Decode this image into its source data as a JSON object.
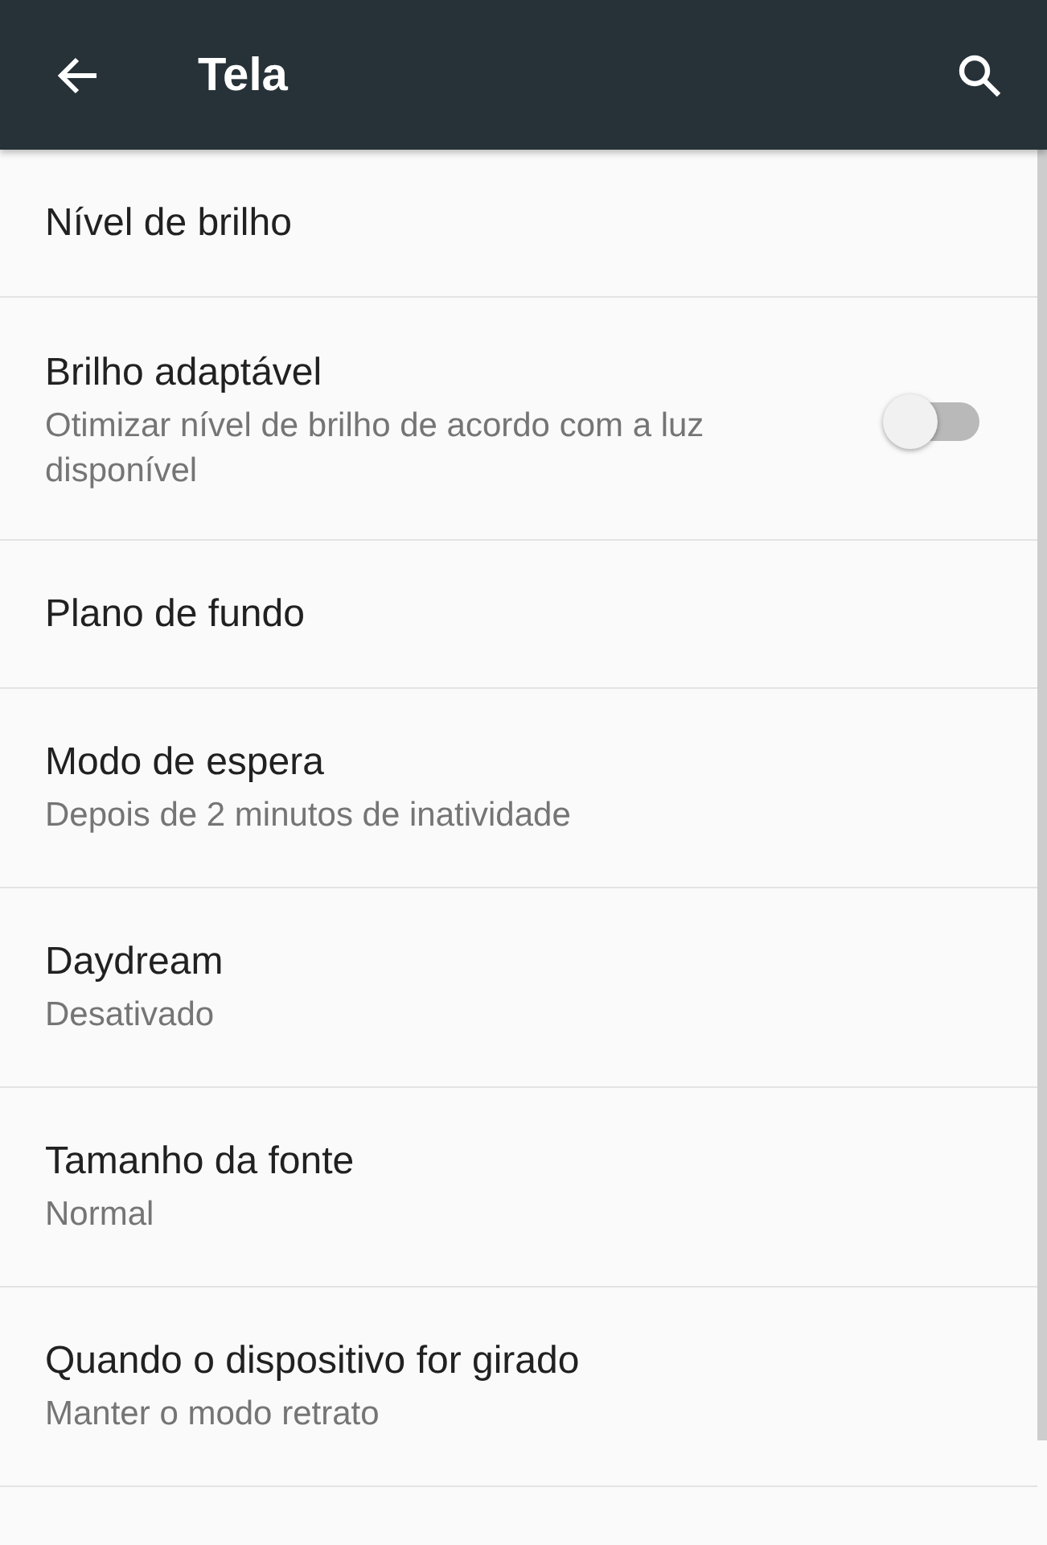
{
  "app_bar": {
    "title": "Tela"
  },
  "settings": [
    {
      "kind": "text",
      "title": "Nível de brilho"
    },
    {
      "kind": "switch",
      "title": "Brilho adaptável",
      "subtitle": "Otimizar nível de brilho de acordo com a luz disponível",
      "on": false
    },
    {
      "kind": "text",
      "title": "Plano de fundo"
    },
    {
      "kind": "text",
      "title": "Modo de espera",
      "subtitle": "Depois de 2 minutos de inatividade"
    },
    {
      "kind": "text",
      "title": "Daydream",
      "subtitle": "Desativado"
    },
    {
      "kind": "text",
      "title": "Tamanho da fonte",
      "subtitle": "Normal"
    },
    {
      "kind": "text",
      "title": "Quando o dispositivo for girado",
      "subtitle": "Manter o modo retrato"
    }
  ]
}
